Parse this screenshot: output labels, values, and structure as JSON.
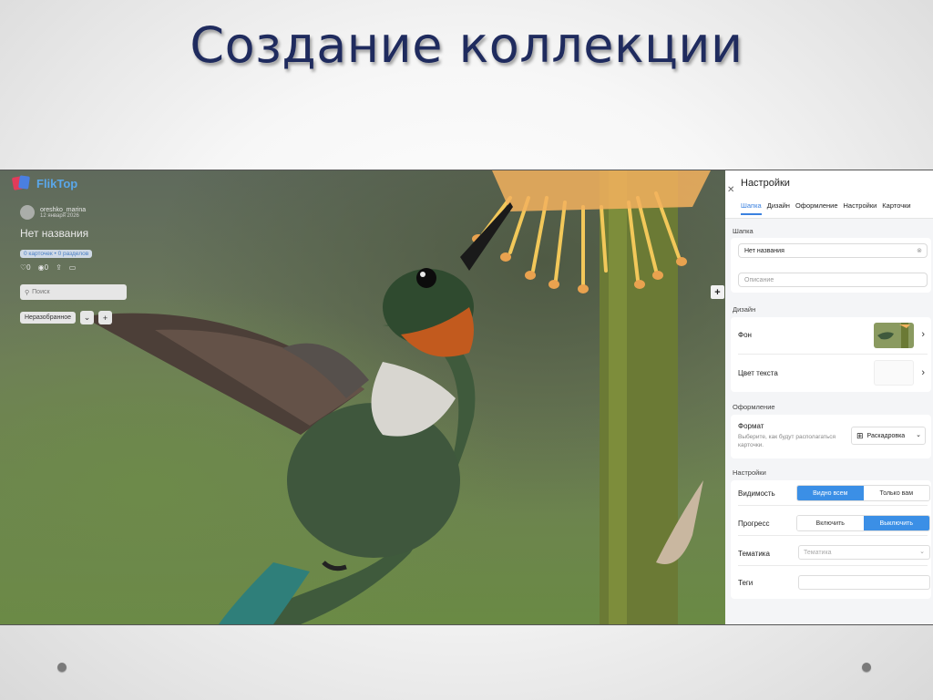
{
  "slide": {
    "title": "Создание коллекции"
  },
  "app": {
    "brand": "FlikTop",
    "user": {
      "name": "oreshko_marina",
      "date": "12 января 2026"
    },
    "collection_title": "Нет названия",
    "counts": "0 карточек • 0 разделов",
    "stats": {
      "likes": "0",
      "views": "0"
    },
    "search_placeholder": "Поиск",
    "filter_chip": "Неразобранное",
    "brand_colors": {
      "accent": "#3b82e0",
      "brand_text": "#5aa7ea",
      "logo_red": "#e23b5a",
      "logo_blue": "#4a7fe0"
    }
  },
  "panel": {
    "title": "Настройки",
    "tabs": [
      "Шапка",
      "Дизайн",
      "Оформление",
      "Настройки",
      "Карточки"
    ],
    "active_tab": "Шапка",
    "header_section": {
      "label": "Шапка",
      "name_value": "Нет названия",
      "description_placeholder": "Описание"
    },
    "design_section": {
      "label": "Дизайн",
      "background_label": "Фон",
      "text_color_label": "Цвет текста"
    },
    "layout_section": {
      "label": "Оформление",
      "format_label": "Формат",
      "format_hint": "Выберите, как будут располагаться карточки.",
      "format_value": "Раскадровка"
    },
    "settings_section": {
      "label": "Настройки",
      "visibility_label": "Видимость",
      "visibility_options": [
        "Видно всем",
        "Только вам"
      ],
      "visibility_selected": "Видно всем",
      "progress_label": "Прогресс",
      "progress_options": [
        "Включить",
        "Выключить"
      ],
      "progress_selected": "Выключить",
      "topic_label": "Тематика",
      "topic_placeholder": "Тематика",
      "tags_label": "Теги"
    }
  }
}
